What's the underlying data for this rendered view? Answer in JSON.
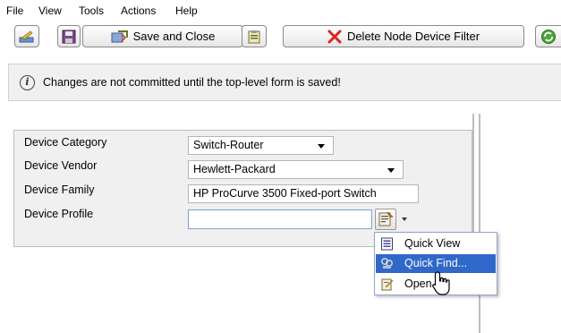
{
  "menu": {
    "items": [
      "File",
      "View",
      "Tools",
      "Actions",
      "Help"
    ]
  },
  "toolbar": {
    "save_close_label": "Save and Close",
    "delete_filter_label": "Delete Node Device Filter"
  },
  "info": {
    "message": "Changes are not committed until the top-level form is saved!"
  },
  "form": {
    "category_label": "Device Category",
    "category_value": "Switch-Router",
    "vendor_label": "Device Vendor",
    "vendor_value": "Hewlett-Packard",
    "family_label": "Device Family",
    "family_value": "HP ProCurve 3500 Fixed-port Switch",
    "profile_label": "Device Profile",
    "profile_value": ""
  },
  "popup_menu": {
    "items": [
      {
        "label": "Quick View",
        "icon": "quick-view-icon"
      },
      {
        "label": "Quick Find...",
        "icon": "quick-find-icon"
      },
      {
        "label": "Open",
        "icon": "open-icon"
      }
    ]
  },
  "colors": {
    "highlight": "#2f68c9",
    "delete_x": "#e02020",
    "panel_bg": "#f0f0f0"
  }
}
